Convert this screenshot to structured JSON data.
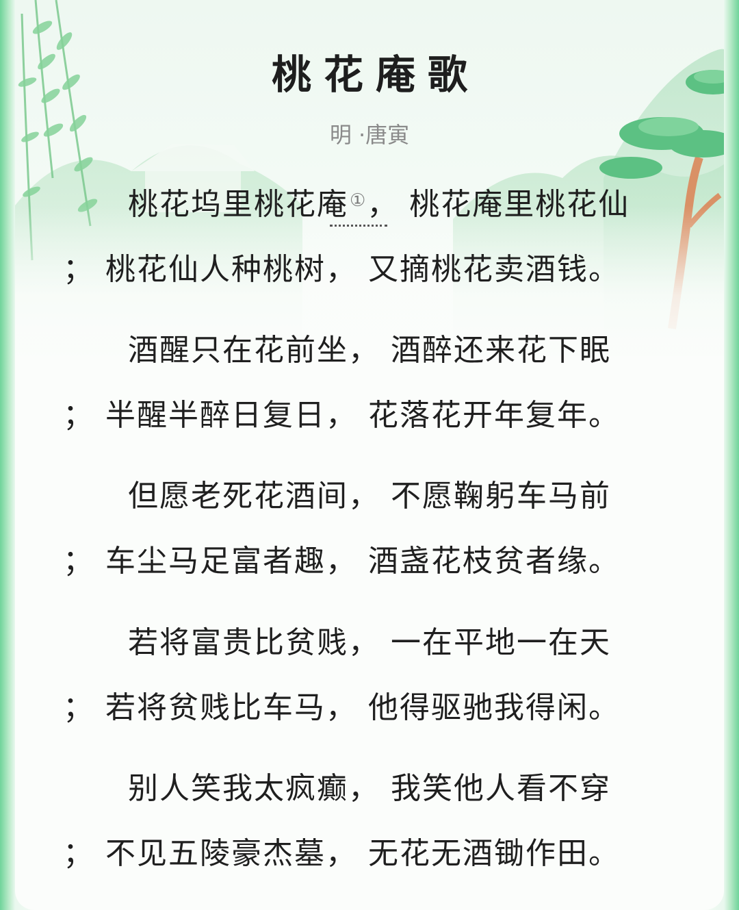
{
  "title": "桃花庵歌",
  "byline": "明 ·唐寅",
  "footnote_marker": "①",
  "lines": [
    "桃花坞里桃花庵",
    "，  桃花庵里桃花仙",
    "；  桃花仙人种桃树，  又摘桃花卖酒钱。",
    "酒醒只在花前坐，  酒醉还来花下眠",
    "；  半醒半醉日复日，  花落花开年复年。",
    "但愿老死花酒间，  不愿鞠躬车马前",
    "；  车尘马足富者趣，  酒盏花枝贫者缘。",
    "若将富贵比贫贱，  一在平地一在天",
    "；  若将贫贱比车马，  他得驱驰我得闲。",
    "别人笑我太疯癫，  我笑他人看不穿",
    "；  不见五陵豪杰墓，  无花无酒锄作田。"
  ],
  "colors": {
    "accent_green": "#6fd49a",
    "text": "#1f1f1f",
    "byline": "#8a8a8a"
  }
}
